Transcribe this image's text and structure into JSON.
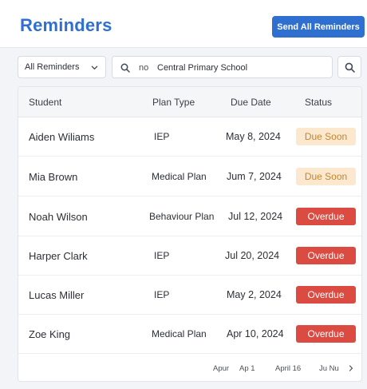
{
  "header": {
    "title": "Reminders",
    "send_all_label": "Send All Reminders"
  },
  "filters": {
    "type_select": "All Reminders",
    "search_prefix": "no",
    "search_value": "Central Primary School"
  },
  "table": {
    "columns": [
      "Student",
      "Plan Type",
      "Due Date",
      "Status"
    ],
    "rows": [
      {
        "student": "Aiden Wiliams",
        "plan": "IEP",
        "date": "May 8, 2024",
        "status": "Due Soon",
        "kind": "due"
      },
      {
        "student": "Mia Brown",
        "plan": "Medical Plan",
        "date": "Jum 7, 2024",
        "status": "Due Soon",
        "kind": "due"
      },
      {
        "student": "Noah Wilson",
        "plan": "Behaviour Plan",
        "date": "Jul 12, 2024",
        "status": "Overdue",
        "kind": "over"
      },
      {
        "student": "Harper Clark",
        "plan": "IEP",
        "date": "Jul 20, 2024",
        "status": "Overdue",
        "kind": "over"
      },
      {
        "student": "Lucas Miller",
        "plan": "IEP",
        "date": "May 2, 2024",
        "status": "Overdue",
        "kind": "over"
      },
      {
        "student": "Zoe King",
        "plan": "Medical Plan",
        "date": "Apr 10, 2024",
        "status": "Overdue",
        "kind": "over"
      }
    ]
  },
  "pagination": {
    "items": [
      "Apur",
      "Ap 1",
      "April 16",
      "Ju Nu"
    ]
  },
  "colors": {
    "accent": "#2f6fcf",
    "due_soon_bg": "#fbe8cf",
    "due_soon_text": "#c2862e",
    "overdue_bg": "#dc4b41"
  }
}
